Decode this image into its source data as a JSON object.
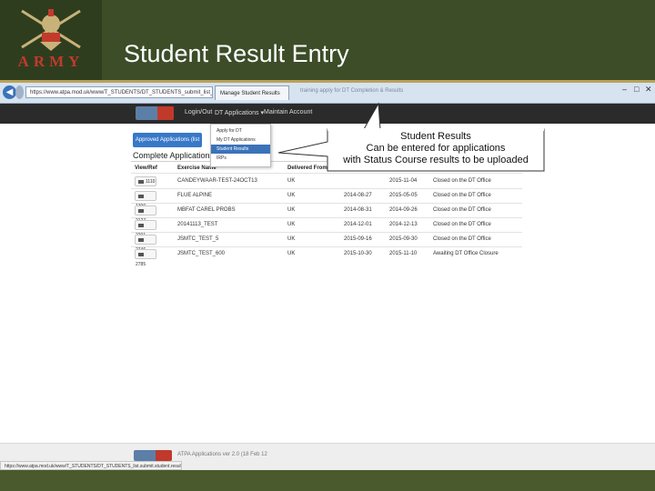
{
  "slide": {
    "title": "Student Result Entry",
    "logo_word": "ARMY",
    "colors": {
      "header": "#3c4d28",
      "accent": "#b8a15a",
      "logo_red": "#c23a2b"
    }
  },
  "browser": {
    "address": "https://www.atpa.mod.uk/www/T_STUDENTS/DT_STUDENTS_submit_list_submi",
    "tab_label": "Manage Student Results",
    "bg_tab_text": "training apply for DT Completion & Results",
    "back_icon": "back-arrow-icon",
    "forward_icon": "forward-arrow-icon"
  },
  "app_nav": {
    "items": [
      "Login/Out",
      "DT Applications ▾",
      "Maintain Account"
    ]
  },
  "dropdown": {
    "items": [
      "Apply for DT",
      "My DT Applications",
      "Student Results",
      "IRPs"
    ],
    "active_index": 2
  },
  "approved_button": "Approved Applications (list",
  "list_heading": "Complete Applications (list",
  "table": {
    "headers": [
      "View/Ref",
      "Exercise Name",
      "Delivered From",
      "",
      "",
      ""
    ],
    "rows": [
      {
        "ref": "1110",
        "name": "CANDEYWAAR-TEST-24OCT13",
        "from": "UK",
        "start": "",
        "end": "2015-11-04",
        "status": "Closed on the DT Office"
      },
      {
        "ref": "1300",
        "name": "FLUE ALPINE",
        "from": "UK",
        "start": "2014-08-27",
        "end": "2015-05-05",
        "status": "Closed on the DT Office"
      },
      {
        "ref": "2127",
        "name": "MBFAT CAREL PROBS",
        "from": "UK",
        "start": "2014-08-31",
        "end": "2014-09-26",
        "status": "Closed on the DT Office"
      },
      {
        "ref": "2201",
        "name": "20141113_TEST",
        "from": "UK",
        "start": "2014-12-01",
        "end": "2014-12-13",
        "status": "Closed on the DT Office"
      },
      {
        "ref": "2746",
        "name": "JSMTC_TEST_5",
        "from": "UK",
        "start": "2015-09-16",
        "end": "2015-09-30",
        "status": "Closed on the DT Office"
      },
      {
        "ref": "2785",
        "name": "JSMTC_TEST_600",
        "from": "UK",
        "start": "2015-10-30",
        "end": "2015-11-10",
        "status": "Awaiting DT Office Closure"
      }
    ]
  },
  "callout": {
    "lines": [
      "Student Results",
      "Can be entered for applications",
      "with Status Course results to be uploaded"
    ]
  },
  "footer": {
    "version": "ATPA Applications ver 2.0 (18 Feb 12",
    "status_url": "https://www.atpa.mod.uk/www/T_STUDENTS/DT_STUDENTS_list.submit.student.results.asp"
  }
}
